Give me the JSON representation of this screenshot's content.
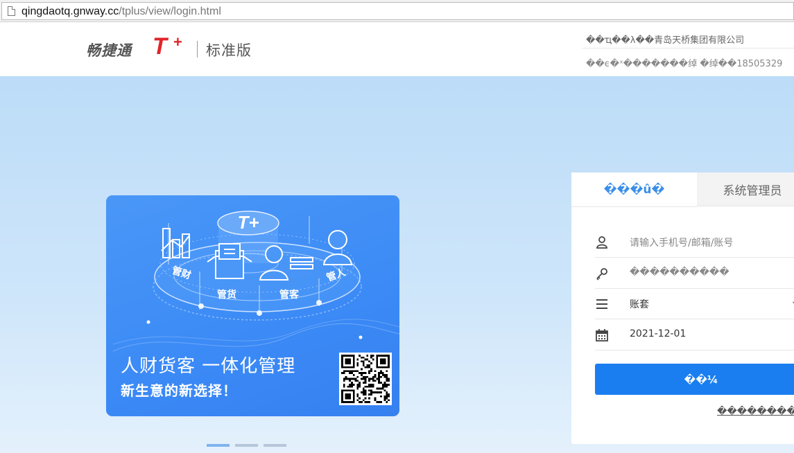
{
  "browser": {
    "url_host": "qingdaotq.gnway.cc",
    "url_path": "/tplus/view/login.html"
  },
  "header": {
    "brand_cn": "畅捷通",
    "brand_t": "T",
    "brand_plus": "+",
    "brand_edition": "标准版",
    "info_line1": "��ҵ��λ��青岛天桥集团有限公司",
    "info_line2": "��ϵ�ˣ�������绰 �绰��18505329"
  },
  "banner": {
    "logo_text": "T+",
    "labels": [
      "管财",
      "管货",
      "管客",
      "管人"
    ],
    "title": "人财货客 一体化管理",
    "subtitle": "新生意的新选择！",
    "carousel_count": 3,
    "carousel_active": 0
  },
  "login": {
    "tabs": [
      "���û�",
      "系统管理员"
    ],
    "active_tab": 0,
    "username_placeholder": "请输入手机号/邮箱/账号",
    "password_placeholder": "����������",
    "account_label": "账套",
    "date_value": "2021-12-01",
    "login_button": "��¼",
    "forgot_link": "��������"
  },
  "colors": {
    "brand_red": "#e0262a",
    "primary_blue": "#1a7ef0",
    "banner_blue": "#3b8af6",
    "page_bg": "#cfe6fa"
  }
}
